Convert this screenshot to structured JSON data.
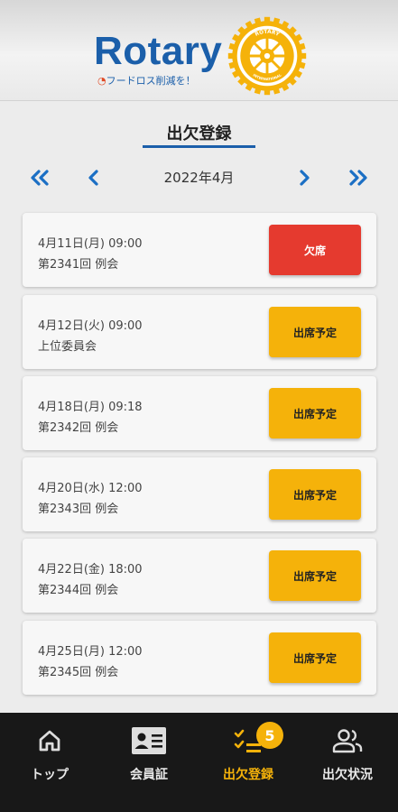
{
  "header": {
    "logo_text": "Rotary",
    "logo_tagline": "フードロス削減を！",
    "logo_tagline_mark": "◔",
    "wheel_text_top": "ROTARY",
    "wheel_text_bottom": "INTERNATIONAL"
  },
  "page": {
    "title": "出欠登録"
  },
  "month_nav": {
    "label": "2022年4月",
    "icons": [
      "double-chevron-left-icon",
      "chevron-left-icon",
      "chevron-right-icon",
      "double-chevron-right-icon"
    ]
  },
  "meetings": [
    {
      "datetime": "4月11日(月) 09:00",
      "name": "第2341回 例会",
      "status": "欠席",
      "status_type": "absent"
    },
    {
      "datetime": "4月12日(火) 09:00",
      "name": "上位委員会",
      "status": "出席予定",
      "status_type": "planned"
    },
    {
      "datetime": "4月18日(月) 09:18",
      "name": "第2342回 例会",
      "status": "出席予定",
      "status_type": "planned"
    },
    {
      "datetime": "4月20日(水) 12:00",
      "name": "第2343回 例会",
      "status": "出席予定",
      "status_type": "planned"
    },
    {
      "datetime": "4月22日(金) 18:00",
      "name": "第2344回 例会",
      "status": "出席予定",
      "status_type": "planned"
    },
    {
      "datetime": "4月25日(月) 12:00",
      "name": "第2345回 例会",
      "status": "出席予定",
      "status_type": "planned"
    }
  ],
  "bottom_nav": {
    "items": [
      {
        "label": "トップ",
        "icon": "home-icon"
      },
      {
        "label": "会員証",
        "icon": "id-card-icon"
      },
      {
        "label": "出欠登録",
        "icon": "checklist-icon",
        "active": true
      },
      {
        "label": "出欠状況",
        "icon": "people-icon"
      }
    ],
    "badge_count": "5"
  },
  "colors": {
    "brand_blue": "#1b5faa",
    "nav_blue": "#1b6fc4",
    "absent_red": "#e53a2f",
    "planned_yellow": "#f5b20a",
    "gold": "#f5b20a",
    "bottom_nav_bg": "#181818"
  }
}
